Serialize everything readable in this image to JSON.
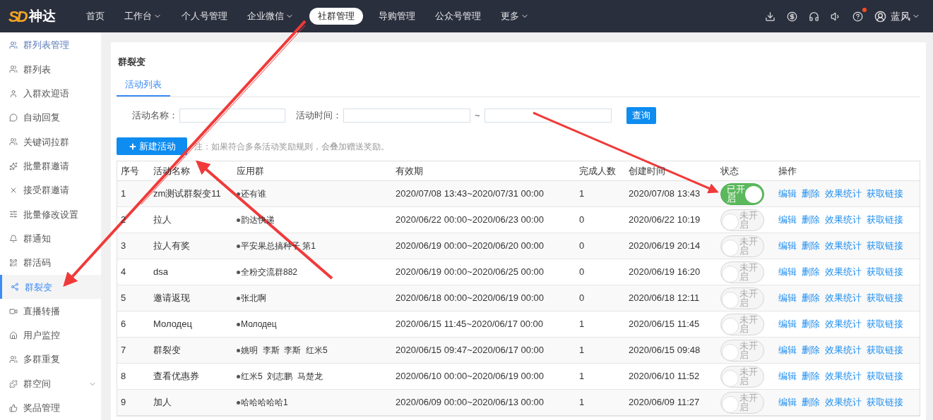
{
  "brand": {
    "mark": "SD",
    "name": "神达"
  },
  "nav": [
    {
      "label": "首页",
      "dropdown": false,
      "selected": false
    },
    {
      "label": "工作台",
      "dropdown": true,
      "selected": false
    },
    {
      "label": "个人号管理",
      "dropdown": false,
      "selected": false
    },
    {
      "label": "企业微信",
      "dropdown": true,
      "selected": false
    },
    {
      "label": "社群管理",
      "dropdown": false,
      "selected": true
    },
    {
      "label": "导购管理",
      "dropdown": false,
      "selected": false
    },
    {
      "label": "公众号管理",
      "dropdown": false,
      "selected": false
    },
    {
      "label": "更多",
      "dropdown": true,
      "selected": false
    }
  ],
  "user": {
    "name": "蓝风",
    "notification": true
  },
  "sidebar": [
    {
      "label": "群列表管理",
      "kind": "header",
      "selected": false
    },
    {
      "label": "群列表",
      "kind": "item",
      "selected": false
    },
    {
      "label": "入群欢迎语",
      "kind": "item",
      "selected": false
    },
    {
      "label": "自动回复",
      "kind": "item",
      "selected": false
    },
    {
      "label": "关键词拉群",
      "kind": "item",
      "selected": false
    },
    {
      "label": "批量群邀请",
      "kind": "item",
      "selected": false
    },
    {
      "label": "接受群邀请",
      "kind": "item",
      "selected": false
    },
    {
      "label": "批量修改设置",
      "kind": "item",
      "selected": false
    },
    {
      "label": "群通知",
      "kind": "item",
      "selected": false
    },
    {
      "label": "群活码",
      "kind": "item",
      "selected": false
    },
    {
      "label": "群裂变",
      "kind": "item",
      "selected": true
    },
    {
      "label": "直播转播",
      "kind": "item",
      "selected": false
    },
    {
      "label": "用户监控",
      "kind": "item",
      "selected": false
    },
    {
      "label": "多群重复",
      "kind": "item",
      "selected": false
    },
    {
      "label": "群空间",
      "kind": "group",
      "selected": false
    },
    {
      "label": "奖品管理",
      "kind": "item",
      "selected": false
    }
  ],
  "page_title": "群裂变",
  "tabs": [
    {
      "label": "活动列表",
      "selected": true
    }
  ],
  "filters": {
    "name_label": "活动名称：",
    "time_label": "活动时间：",
    "separator": "~",
    "query_button": "查询"
  },
  "new_button": "新建活动",
  "note": "注：如果符合多条活动奖励规则，会叠加赠送奖励。",
  "table": {
    "columns": [
      "序号",
      "活动名称",
      "应用群",
      "有效期",
      "完成人数",
      "创建时间",
      "状态",
      "操作"
    ],
    "rows": [
      {
        "no": "1",
        "name": "zm测试群裂变11",
        "group": "还有谁",
        "period": "2020/07/08 13:43~2020/07/31 00:00",
        "done": "1",
        "created": "2020/07/08 13:43",
        "on": true,
        "status": "已开启",
        "actions": [
          "编辑",
          "删除",
          "效果统计",
          "获取链接"
        ]
      },
      {
        "no": "2",
        "name": "拉人",
        "group": "韵达快递",
        "period": "2020/06/22 00:00~2020/06/23 00:00",
        "done": "0",
        "created": "2020/06/22 10:19",
        "on": false,
        "status": "未开启",
        "actions": [
          "编辑",
          "删除",
          "效果统计",
          "获取链接"
        ]
      },
      {
        "no": "3",
        "name": "拉人有奖",
        "group": "平安果总搞种子 第1",
        "period": "2020/06/19 00:00~2020/06/20 00:00",
        "done": "0",
        "created": "2020/06/19 20:14",
        "on": false,
        "status": "未开启",
        "actions": [
          "编辑",
          "删除",
          "效果统计",
          "获取链接"
        ]
      },
      {
        "no": "4",
        "name": "dsa",
        "group": "全粉交流群882",
        "period": "2020/06/19 00:00~2020/06/25 00:00",
        "done": "0",
        "created": "2020/06/19 16:20",
        "on": false,
        "status": "未开启",
        "actions": [
          "编辑",
          "删除",
          "效果统计",
          "获取链接"
        ]
      },
      {
        "no": "5",
        "name": "邀请返现",
        "group": "张北啊",
        "period": "2020/06/18 00:00~2020/06/19 00:00",
        "done": "0",
        "created": "2020/06/18 12:11",
        "on": false,
        "status": "未开启",
        "actions": [
          "编辑",
          "删除",
          "效果统计",
          "获取链接"
        ]
      },
      {
        "no": "6",
        "name": "Молодец",
        "group": "Молодец",
        "period": "2020/06/15 11:45~2020/06/17 00:00",
        "done": "1",
        "created": "2020/06/15 11:45",
        "on": false,
        "status": "未开启",
        "actions": [
          "编辑",
          "删除",
          "效果统计",
          "获取链接"
        ]
      },
      {
        "no": "7",
        "name": "群裂变",
        "group": "姚明  李斯  李斯  红米5",
        "period": "2020/06/15 09:47~2020/06/17 00:00",
        "done": "1",
        "created": "2020/06/15 09:48",
        "on": false,
        "status": "未开启",
        "actions": [
          "编辑",
          "删除",
          "效果统计",
          "获取链接"
        ]
      },
      {
        "no": "8",
        "name": "查看优惠券",
        "group": "红米5  刘志鹏  马楚龙",
        "period": "2020/06/10 00:00~2020/06/19 00:00",
        "done": "1",
        "created": "2020/06/10 11:52",
        "on": false,
        "status": "未开启",
        "actions": [
          "编辑",
          "删除",
          "效果统计",
          "获取链接"
        ]
      },
      {
        "no": "9",
        "name": "加人",
        "group": "哈哈哈哈哈1",
        "period": "2020/06/09 00:00~2020/06/13 00:00",
        "done": "1",
        "created": "2020/06/09 11:27",
        "on": false,
        "status": "未开启",
        "actions": [
          "编辑",
          "删除",
          "效果统计",
          "获取链接"
        ]
      }
    ]
  }
}
